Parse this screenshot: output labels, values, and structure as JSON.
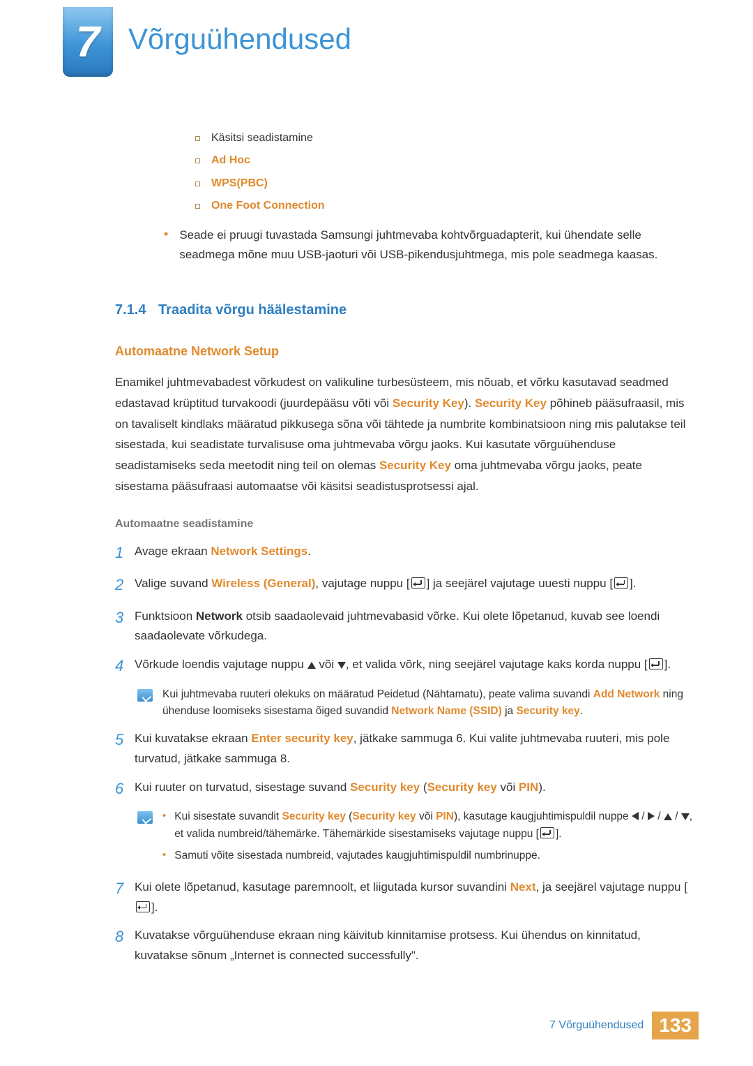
{
  "chapter": {
    "number": "7",
    "title": "Võrguühendused"
  },
  "sublist": {
    "item1": "Käsitsi seadistamine",
    "item2": "Ad Hoc",
    "item3": "WPS(PBC)",
    "item4": "One Foot Connection"
  },
  "dot1": "Seade ei pruugi tuvastada Samsungi juhtmevaba kohtvõrguadapterit, kui ühendate selle seadmega mõne muu USB-jaoturi või USB-pikendusjuhtmega, mis pole seadmega kaasas.",
  "section": {
    "num": "7.1.4",
    "title": "Traadita võrgu häälestamine"
  },
  "subheading1": "Automaatne Network Setup",
  "para1_a": "Enamikel juhtmevabadest võrkudest on valikuline turbesüsteem, mis nõuab, et võrku kasutavad seadmed edastavad krüptitud turvakoodi (juurdepääsu võti või ",
  "para1_sk1": "Security Key",
  "para1_b": "). ",
  "para1_sk2": "Security Key",
  "para1_c": " põhineb pääsufraasil, mis on tavaliselt kindlaks määratud pikkusega sõna või tähtede ja numbrite kombinatsioon ning mis palutakse teil sisestada, kui seadistate turvalisuse oma juhtmevaba võrgu jaoks. Kui kasutate võrguühenduse seadistamiseks seda meetodit ning teil on olemas ",
  "para1_sk3": "Security Key",
  "para1_d": " oma juhtmevaba võrgu jaoks, peate sisestama pääsufraasi automaatse või käsitsi seadistusprotsessi ajal.",
  "subheading2": "Automaatne seadistamine",
  "steps": {
    "s1_a": "Avage ekraan ",
    "s1_b": "Network Settings",
    "s1_c": ".",
    "s2_a": "Valige suvand ",
    "s2_b": "Wireless (General)",
    "s2_c": ", vajutage nuppu [",
    "s2_d": "] ja seejärel vajutage uuesti nuppu [",
    "s2_e": "].",
    "s3_a": "Funktsioon ",
    "s3_b": "Network",
    "s3_c": " otsib saadaolevaid juhtmevabasid võrke. Kui olete lõpetanud, kuvab see loendi saadaolevate võrkudega.",
    "s4_a": "Võrkude loendis vajutage nuppu ",
    "s4_b": " või ",
    "s4_c": ", et valida võrk, ning seejärel vajutage kaks korda nuppu [",
    "s4_d": "].",
    "note4_a": "Kui juhtmevaba ruuteri olekuks on määratud Peidetud (Nähtamatu), peate valima suvandi ",
    "note4_b": "Add Network",
    "note4_c": " ning ühenduse loomiseks sisestama õiged suvandid ",
    "note4_d": "Network Name (SSID)",
    "note4_e": " ja ",
    "note4_f": "Security key",
    "note4_g": ".",
    "s5_a": "Kui kuvatakse ekraan ",
    "s5_b": "Enter security key",
    "s5_c": ", jätkake sammuga 6. Kui valite juhtmevaba ruuteri, mis pole turvatud, jätkake sammuga 8.",
    "s6_a": "Kui ruuter on turvatud, sisestage suvand ",
    "s6_b": "Security key",
    "s6_c": " (",
    "s6_d": "Security key",
    "s6_e": " või ",
    "s6_f": "PIN",
    "s6_g": ").",
    "note6_1a": "Kui sisestate suvandit ",
    "note6_1b": "Security key",
    "note6_1c": " (",
    "note6_1d": "Security key",
    "note6_1e": " või ",
    "note6_1f": "PIN",
    "note6_1g": "), kasutage kaugjuhtimispuldil nuppe ",
    "note6_1h": ", et valida numbreid/tähemärke. Tähemärkide sisestamiseks vajutage nuppu [",
    "note6_1i": "].",
    "note6_2": "Samuti võite sisestada numbreid, vajutades kaugjuhtimispuldil numbrinuppe.",
    "s7_a": "Kui olete lõpetanud, kasutage paremnoolt, et liigutada kursor suvandini ",
    "s7_b": "Next",
    "s7_c": ", ja seejärel vajutage nuppu [",
    "s7_d": "].",
    "s8": "Kuvatakse võrguühenduse ekraan ning käivitub kinnitamise protsess. Kui ühendus on kinnitatud, kuvatakse sõnum „Internet is connected successfully\"."
  },
  "footer": {
    "label": "7 Võrguühendused",
    "page": "133"
  }
}
